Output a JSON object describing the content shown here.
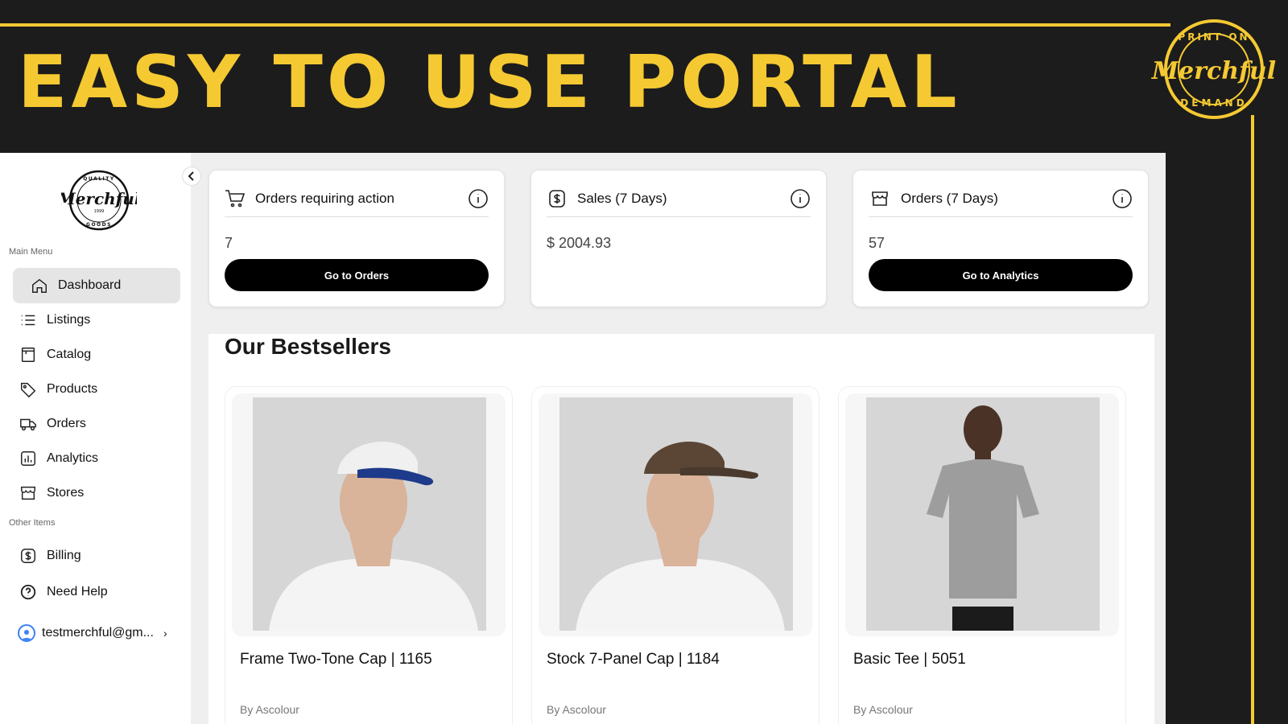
{
  "banner": {
    "headline": "EASY TO USE PORTAL",
    "accent_color": "#f5c932",
    "badge_logo_text": {
      "top": "PRINT ON",
      "brand": "Merchful",
      "bottom": "DEMAND"
    }
  },
  "sidebar": {
    "logo_text": {
      "top": "QUALITY",
      "brand": "Merchful",
      "year": "1999",
      "bottom": "GOODS"
    },
    "main_menu_label": "Main Menu",
    "main_items": [
      {
        "label": "Dashboard",
        "icon": "home-icon",
        "active": true
      },
      {
        "label": "Listings",
        "icon": "list-icon"
      },
      {
        "label": "Catalog",
        "icon": "catalog-icon"
      },
      {
        "label": "Products",
        "icon": "tag-icon"
      },
      {
        "label": "Orders",
        "icon": "truck-icon"
      },
      {
        "label": "Analytics",
        "icon": "analytics-icon"
      },
      {
        "label": "Stores",
        "icon": "store-icon"
      }
    ],
    "other_items_label": "Other Items",
    "other_items": [
      {
        "label": "Billing",
        "icon": "dollar-icon"
      },
      {
        "label": "Need Help",
        "icon": "help-icon"
      }
    ],
    "user_label": "testmerchful@gm..."
  },
  "stats": [
    {
      "title": "Orders requiring action",
      "icon": "cart-icon",
      "value": "7",
      "button": "Go to Orders"
    },
    {
      "title": "Sales (7 Days)",
      "icon": "dollar-icon",
      "value": "$ 2004.93",
      "button": ""
    },
    {
      "title": "Orders (7 Days)",
      "icon": "store-icon",
      "value": "57",
      "button": "Go to Analytics"
    }
  ],
  "bestsellers": {
    "title": "Our Bestsellers",
    "products": [
      {
        "name": "Frame Two-Tone Cap | 1165",
        "by": "By Ascolour"
      },
      {
        "name": "Stock 7-Panel Cap | 1184",
        "by": "By Ascolour"
      },
      {
        "name": "Basic Tee | 5051",
        "by": "By Ascolour"
      }
    ]
  }
}
